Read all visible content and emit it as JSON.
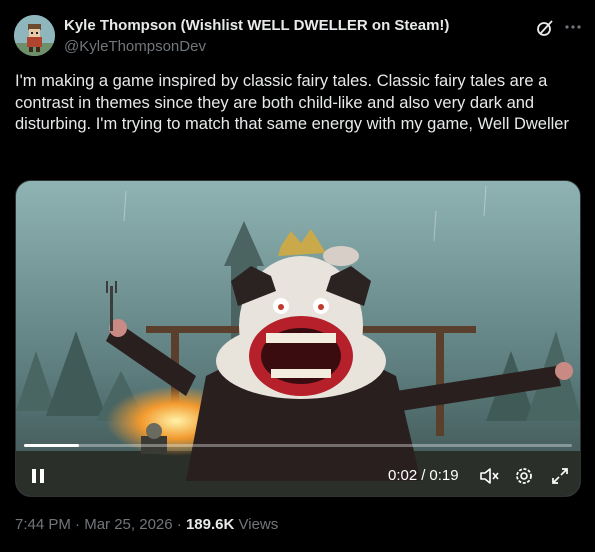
{
  "author": {
    "display_name": "Kyle Thompson (Wishlist WELL DWELLER on Steam!)",
    "handle": "@KyleThompsonDev",
    "avatar_icon": "pixel-character-avatar"
  },
  "header_icons": [
    "grok-icon",
    "more-icon"
  ],
  "tweet": {
    "text": "I'm making a game inspired by classic fairy tales.  Classic fairy tales are a contrast in themes since they are both child-like and also very dark and disturbing.  I'm trying to match that same energy with my game, Well Dweller"
  },
  "video": {
    "current_time": "0:02",
    "separator": "/",
    "duration": "0:19",
    "progress_fraction": 0.1,
    "controls": [
      "pause-icon",
      "mute-icon",
      "settings-icon",
      "fullscreen-icon"
    ]
  },
  "meta": {
    "time": "7:44 PM",
    "dot1": "·",
    "date": "Mar 25, 2026",
    "dot2": "·",
    "views_count": "189.6K",
    "views_label": "Views"
  },
  "colors": {
    "background": "#000000",
    "text_primary": "#e7e9ea",
    "text_secondary": "#71767b",
    "border": "#2f3336"
  }
}
